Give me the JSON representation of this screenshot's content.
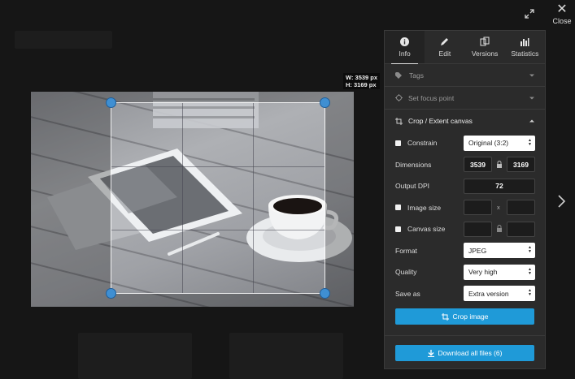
{
  "viewer": {
    "close_label": "Close",
    "dimensions_width": "W: 3539 px",
    "dimensions_height": "H: 3169 px"
  },
  "tabs": [
    {
      "label": "Info",
      "icon": "info-icon",
      "active": true
    },
    {
      "label": "Edit",
      "icon": "pencil-icon",
      "active": false
    },
    {
      "label": "Versions",
      "icon": "versions-icon",
      "active": false
    },
    {
      "label": "Statistics",
      "icon": "bar-chart-icon",
      "active": false
    }
  ],
  "sections": {
    "tags": "Tags",
    "focus": "Set focus point",
    "crop": "Crop / Extent canvas"
  },
  "crop_form": {
    "constrain_label": "Constrain",
    "constrain_value": "Original (3:2)",
    "dimensions_label": "Dimensions",
    "dimensions_w": "3539",
    "dimensions_h": "3169",
    "dpi_label": "Output DPI",
    "dpi_value": "72",
    "image_size_label": "Image size",
    "image_size_sep": "x",
    "canvas_size_label": "Canvas size",
    "format_label": "Format",
    "format_value": "JPEG",
    "quality_label": "Quality",
    "quality_value": "Very high",
    "save_as_label": "Save as",
    "save_as_value": "Extra version",
    "crop_button": "Crop image"
  },
  "download_button": "Download all files (6)",
  "colors": {
    "accent": "#1f9ad8",
    "crop_handle": "#3f8fd2",
    "panel_bg": "#2b2b2b"
  }
}
